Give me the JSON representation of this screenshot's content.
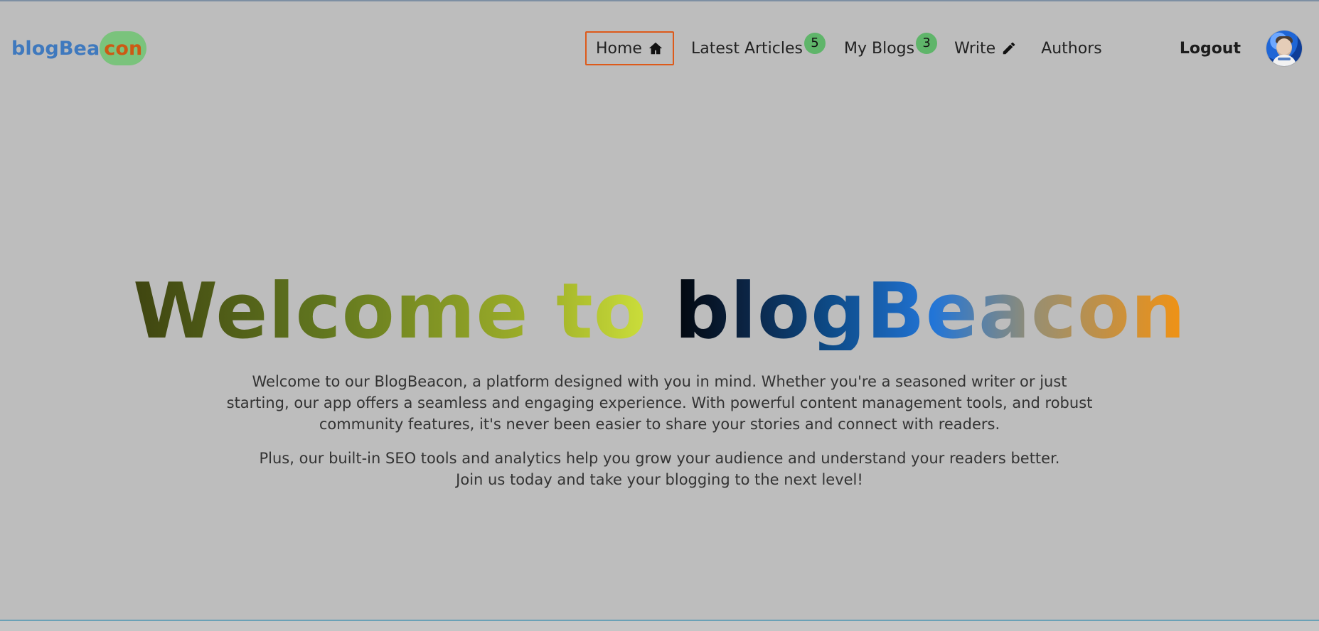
{
  "nav": {
    "brand": {
      "left": "blogBea",
      "right": "con"
    },
    "items": [
      {
        "label": "Home",
        "icon": "home-icon",
        "active": true
      },
      {
        "label": "Latest Articles",
        "badge": "5"
      },
      {
        "label": "My Blogs",
        "badge": "3"
      },
      {
        "label": "Write",
        "icon": "pencil-icon"
      },
      {
        "label": "Authors"
      }
    ],
    "logout": "Logout"
  },
  "hero": {
    "title": "Welcome to blogBeacon",
    "p1": "Welcome to our BlogBeacon, a platform designed with you in mind. Whether you're a seasoned writer or just starting, our app offers a seamless and engaging experience. With powerful content management tools, and robust community features, it's never been easier to share your stories and connect with readers.",
    "p2": "Plus, our built-in SEO tools and analytics help you grow your audience and understand your readers better. Join us today and take your blogging to the next level!"
  },
  "colors": {
    "background": "#bdbdbd",
    "brand_blue": "#3f79be",
    "brand_orange": "#cc5a14",
    "badge_green": "#5fb56a",
    "active_border": "#dd5a1a"
  }
}
